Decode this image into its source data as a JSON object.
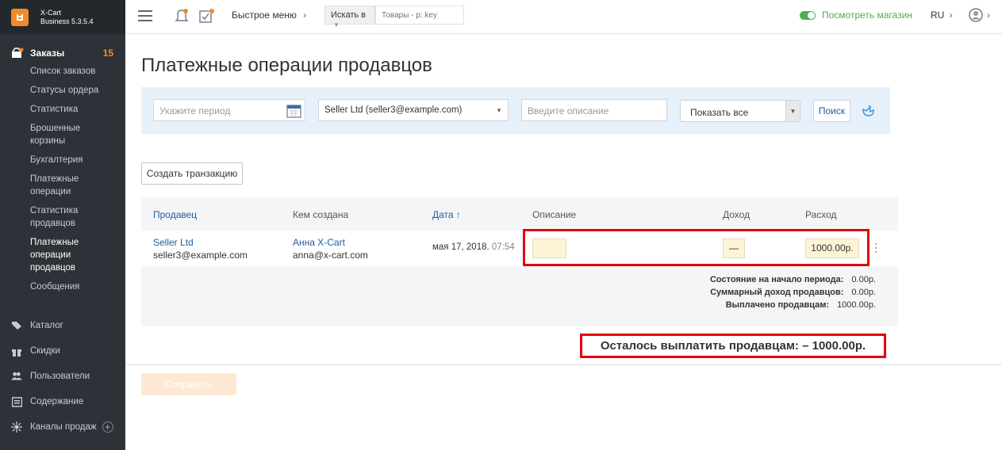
{
  "brand": {
    "name": "X-Cart",
    "edition": "Business 5.3.5.4"
  },
  "sidebar": {
    "orders": {
      "label": "Заказы",
      "count": "15"
    },
    "order_items": [
      {
        "label": "Список заказов"
      },
      {
        "label": "Статусы ордера"
      },
      {
        "label": "Статистика"
      },
      {
        "label": "Брошенные корзины"
      },
      {
        "label": "Бухгалтерия"
      },
      {
        "label": "Платежные операции"
      },
      {
        "label": "Статистика продавцов"
      },
      {
        "label": "Платежные операции продавцов"
      },
      {
        "label": "Сообщения"
      }
    ],
    "main_items": [
      {
        "label": "Каталог"
      },
      {
        "label": "Скидки"
      },
      {
        "label": "Пользователи"
      },
      {
        "label": "Содержание"
      },
      {
        "label": "Каналы продаж"
      }
    ]
  },
  "topbar": {
    "quick_menu": "Быстрое меню",
    "search_in": "Искать в",
    "search_placeholder": "Товары - p: key",
    "view_store": "Посмотреть магазин",
    "lang": "RU"
  },
  "page": {
    "title": "Платежные операции продавцов"
  },
  "filters": {
    "period_placeholder": "Укажите период",
    "seller_selected": "Seller Ltd (seller3@example.com)",
    "description_placeholder": "Введите описание",
    "show_selected": "Показать все",
    "search_button": "Поиск"
  },
  "create_button": "Создать транзакцию",
  "table": {
    "headers": {
      "seller": "Продавец",
      "created_by": "Кем создана",
      "date": "Дата",
      "description": "Описание",
      "income": "Доход",
      "expense": "Расход"
    },
    "rows": [
      {
        "seller_name": "Seller Ltd",
        "seller_email": "seller3@example.com",
        "creator_name": "Анна X-Cart",
        "creator_email": "anna@x-cart.com",
        "date": "мая 17, 2018.",
        "time": "07:54",
        "income": "—",
        "expense": "1000.00р."
      }
    ],
    "summary": [
      {
        "label": "Состояние на начало периода:",
        "value": "0.00р."
      },
      {
        "label": "Суммарный доход продавцов:",
        "value": "0.00р."
      },
      {
        "label": "Выплачено продавцам:",
        "value": "1000.00р."
      }
    ]
  },
  "total_label": "Осталось выплатить продавцам: – 1000.00р.",
  "save_button": "Сохранить",
  "colors": {
    "accent": "#f28a2a",
    "link": "#1d5d9f",
    "highlight": "#e3000f",
    "store_toggle": "#4caf50"
  }
}
